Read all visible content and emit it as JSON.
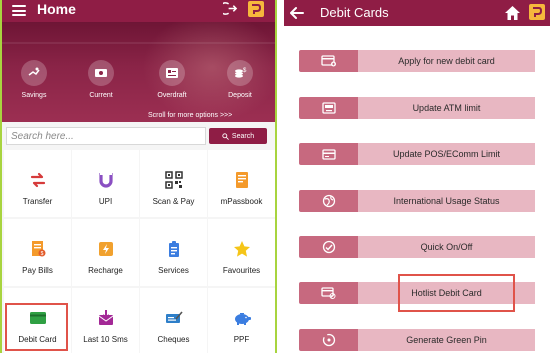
{
  "left_screen": {
    "appbar": {
      "title": "Home",
      "menu_icon": "hamburger-icon",
      "logout_icon": "logout-icon",
      "logo_icon": "bank-logo-icon",
      "bar_color": "#8f1d45"
    },
    "quick_actions": [
      {
        "label": "Savings",
        "icon": "savings-icon"
      },
      {
        "label": "Current",
        "icon": "current-account-icon"
      },
      {
        "label": "Overdraft",
        "icon": "overdraft-icon"
      },
      {
        "label": "Deposit",
        "icon": "deposit-icon"
      }
    ],
    "scroll_hint": "Scroll for more options >>>",
    "search": {
      "placeholder": "Search here...",
      "button_label": "Search"
    },
    "tiles": [
      {
        "label": "Transfer",
        "icon": "transfer-icon"
      },
      {
        "label": "UPI",
        "icon": "upi-icon"
      },
      {
        "label": "Scan & Pay",
        "icon": "qr-code-icon"
      },
      {
        "label": "mPassbook",
        "icon": "passbook-icon"
      },
      {
        "label": "Pay Bills",
        "icon": "bill-icon"
      },
      {
        "label": "Recharge",
        "icon": "recharge-icon"
      },
      {
        "label": "Services",
        "icon": "services-icon"
      },
      {
        "label": "Favourites",
        "icon": "star-icon"
      },
      {
        "label": "Debit Card",
        "icon": "debit-card-icon"
      },
      {
        "label": "Last 10 Sms",
        "icon": "sms-icon"
      },
      {
        "label": "Cheques",
        "icon": "cheque-icon"
      },
      {
        "label": "PPF",
        "icon": "piggy-bank-icon"
      }
    ],
    "highlight_color": "#e0534a"
  },
  "right_screen": {
    "appbar": {
      "title": "Debit Cards",
      "back_icon": "back-arrow-icon",
      "home_icon": "home-icon",
      "logo_icon": "bank-logo-icon"
    },
    "menu_items": [
      {
        "label": "Apply for new debit card",
        "icon": "new-card-icon"
      },
      {
        "label": "Update ATM limit",
        "icon": "atm-icon"
      },
      {
        "label": "Update POS/EComm Limit",
        "icon": "pos-card-icon"
      },
      {
        "label": "International Usage Status",
        "icon": "globe-icon"
      },
      {
        "label": "Quick On/Off",
        "icon": "toggle-card-icon"
      },
      {
        "label": "Hotlist Debit Card",
        "icon": "block-card-icon"
      },
      {
        "label": "Generate Green Pin",
        "icon": "pin-icon"
      }
    ],
    "colors": {
      "icon_box": "#c7697f",
      "label_box": "#e8b7c2"
    }
  }
}
